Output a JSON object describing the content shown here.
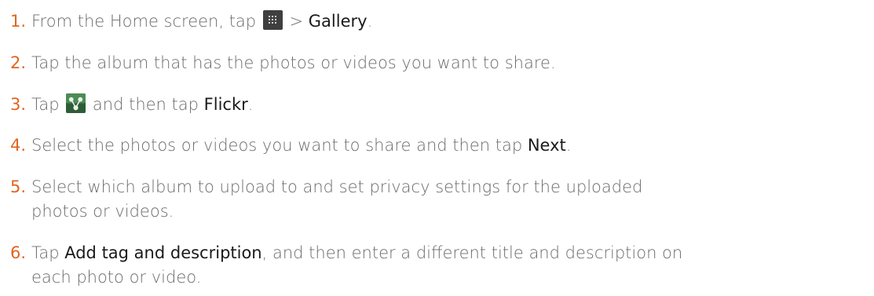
{
  "steps": [
    {
      "num": "1.",
      "parts": {
        "a": "From the Home screen, tap ",
        "b": " > ",
        "c": "Gallery",
        "d": "."
      }
    },
    {
      "num": "2.",
      "text": "Tap the album that has the photos or videos you want to share."
    },
    {
      "num": "3.",
      "parts": {
        "a": "Tap ",
        "b": " and then tap ",
        "c": "Flickr",
        "d": "."
      }
    },
    {
      "num": "4.",
      "parts": {
        "a": "Select the photos or videos you want to share and then tap ",
        "b": "Next",
        "c": "."
      }
    },
    {
      "num": "5.",
      "text1": "Select which album to upload to and set privacy settings for the uploaded",
      "text2": "photos or videos."
    },
    {
      "num": "6.",
      "parts": {
        "a": "Tap ",
        "b": "Add tag and description",
        "c": ", and then enter a different title and description on",
        "d": "each photo or video."
      }
    }
  ],
  "icons": {
    "step1": "all-apps-grid-icon",
    "step3": "share-icon"
  },
  "colors": {
    "step_number": "#e0651e",
    "body_text": "#6b6b6b",
    "ui_label": "#1a1a1a"
  }
}
